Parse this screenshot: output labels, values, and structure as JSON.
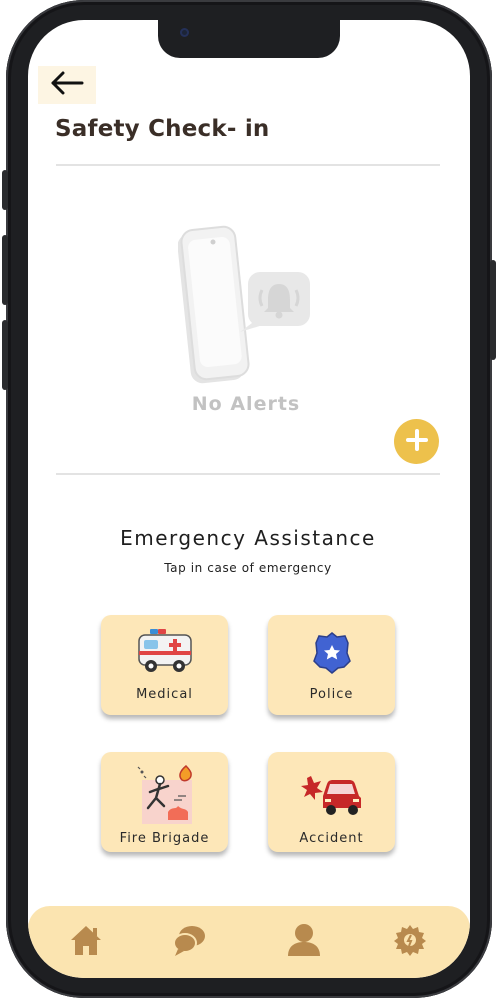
{
  "header": {
    "title": "Safety Check- in",
    "back_icon": "arrow-left-icon"
  },
  "alerts": {
    "empty_text": "No Alerts",
    "illustration_icon": "phone-bell-icon",
    "add_icon": "plus-icon"
  },
  "emergency": {
    "title": "Emergency Assistance",
    "subtitle": "Tap in case of emergency",
    "cards": [
      {
        "label": "Medical",
        "icon": "ambulance-icon"
      },
      {
        "label": "Police",
        "icon": "police-badge-icon"
      },
      {
        "label": "Fire Brigade",
        "icon": "fire-escape-icon"
      },
      {
        "label": "Accident",
        "icon": "car-crash-icon"
      }
    ]
  },
  "bottom_nav": {
    "items": [
      {
        "icon": "home-icon"
      },
      {
        "icon": "chat-icon"
      },
      {
        "icon": "user-icon"
      },
      {
        "icon": "settings-icon"
      }
    ]
  },
  "colors": {
    "accent": "#edc14c",
    "card_bg": "#fde7b8",
    "nav_bg": "#fbe4b0",
    "nav_icon": "#b88a4e",
    "title_text": "#3a2e27"
  }
}
